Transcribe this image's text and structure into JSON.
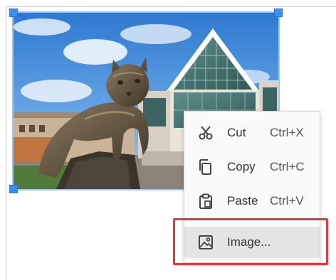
{
  "context_menu": {
    "items": [
      {
        "label": "Cut",
        "shortcut": "Ctrl+X",
        "icon": "scissors-icon"
      },
      {
        "label": "Copy",
        "shortcut": "Ctrl+C",
        "icon": "copy-icon"
      },
      {
        "label": "Paste",
        "shortcut": "Ctrl+V",
        "icon": "clipboard-icon"
      },
      {
        "label": "Image...",
        "icon": "image-icon",
        "highlighted": true
      }
    ]
  },
  "image": {
    "content": "photo-statue-building"
  },
  "colors": {
    "selection_handle": "#3d8df5",
    "highlight_box": "#e0393e",
    "menu_hover": "#e4e4e4"
  }
}
